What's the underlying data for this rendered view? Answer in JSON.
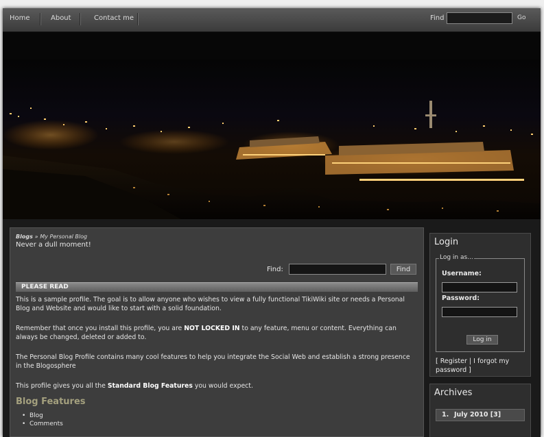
{
  "nav": {
    "items": [
      "Home",
      "About",
      "Contact me"
    ],
    "find_label": "Find",
    "go_label": "Go"
  },
  "main": {
    "breadcrumb_section": "Blogs",
    "breadcrumb_sep": "»",
    "breadcrumb_title": "My Personal Blog",
    "tagline": "Never a dull moment!",
    "find_label": "Find:",
    "find_button": "Find",
    "please_read": "PLEASE READ",
    "para1": "This is a sample profile. The goal is to allow anyone who wishes to view a fully functional TikiWiki site or needs a Personal Blog and Website and would like to start with a solid foundation.",
    "para2_pre": "Remember that once you install this profile, you are ",
    "para2_bold": "NOT LOCKED IN",
    "para2_post": " to any feature, menu or content. Everything can always be changed, deleted or added to.",
    "para3": "The Personal Blog Profile contains many cool features to help you integrate the Social Web and establish a strong presence in the Blogosphere",
    "para4_pre": "This profile gives you all the ",
    "para4_bold": "Standard Blog Features",
    "para4_post": " you would expect.",
    "features_heading": "Blog Features",
    "features": [
      "Blog",
      "Comments"
    ]
  },
  "login": {
    "title": "Login",
    "legend": "Log in as...",
    "username_label": "Username:",
    "password_label": "Password:",
    "button": "Log in",
    "register": "Register",
    "sep": "|",
    "forgot": "I forgot my password"
  },
  "archives": {
    "title": "Archives",
    "items": [
      {
        "num": "1.",
        "label": "July 2010 [3]"
      }
    ]
  },
  "colors": {
    "page_bg": "#1a1a1a",
    "panel": "#3d3d3d",
    "heading_accent": "#a4a07e"
  }
}
